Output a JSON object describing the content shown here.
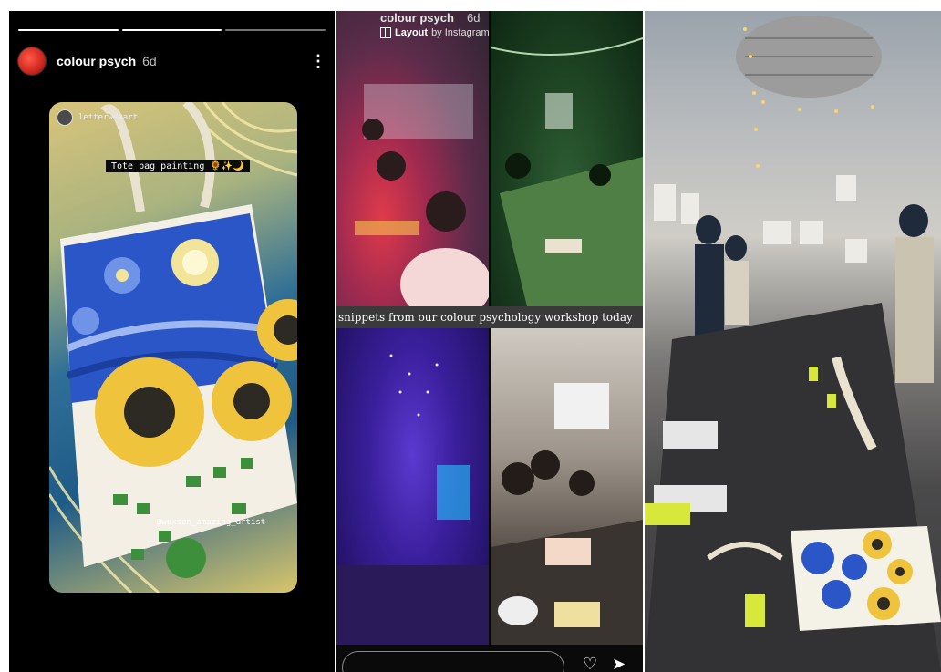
{
  "story": {
    "progress_segments": 3,
    "progress_done": 2,
    "username": "colour psych",
    "age": "6d",
    "more_label": "⋮",
    "reshare_name": "letterwskart",
    "caption_sticker": "Tote bag painting 🌻✨🌙",
    "credit_sticker": "@woxsen_amazing_artist",
    "accent": "#d42a20"
  },
  "collage": {
    "overlay_username": "colour psych",
    "overlay_age": "6d",
    "layout_label": "Layout",
    "layout_by": "by Instagram",
    "banner": "snippets from our colour psychology workshop today",
    "heart_icon": "heart-icon",
    "send_icon": "send-icon"
  }
}
